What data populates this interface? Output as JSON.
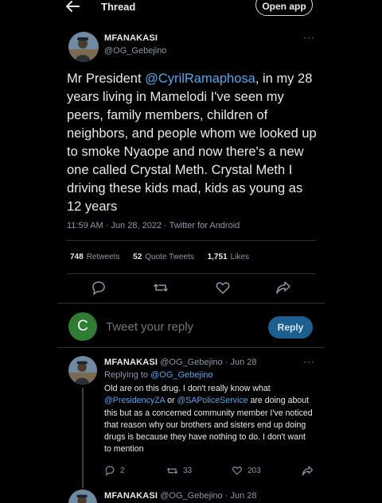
{
  "header": {
    "title": "Thread",
    "open_app": "Open app"
  },
  "tweet": {
    "author_name": "MFANAKASI",
    "author_handle": "@OG_Gebejino",
    "body_prefix": "Mr President ",
    "body_mention": "@CyrilRamaphosa",
    "body_rest": ", in my 28 years living in Mamelodi I've seen my peers, family members, children of neighbors, and people whom we looked up to smoke Nyaope and now there's a new one called Crystal Meth. Crystal Meth I driving these kids mad, kids as young as 12 years",
    "timestamp": "11:59 AM · Jun 28, 2022 · Twitter for Android",
    "stats": {
      "retweets": "748",
      "retweets_label": "Retweets",
      "quotes": "52",
      "quotes_label": "Quote Tweets",
      "likes": "1,751",
      "likes_label": "Likes"
    }
  },
  "compose": {
    "avatar_letter": "C",
    "avatar_color": "#2e7d32",
    "placeholder": "Tweet your reply",
    "button": "Reply"
  },
  "reply": {
    "author_name": "MFANAKASI",
    "meta": "@OG_Gebejino · Jun 28",
    "replying_prefix": "Replying to ",
    "replying_handle": "@OG_Gebejino",
    "text_1": "Old are on this drug. I don't really know what ",
    "mention_1": "@PresidencyZA",
    "text_2": " or ",
    "mention_2": "@SAPoliceService",
    "text_3": " are doing about this but as a concerned community member I've noticed that reason why our brothers and sisters end up doing drugs is because they have nothing to do. I don't want to mention",
    "replies": "2",
    "retweets": "33",
    "likes": "203"
  },
  "next_reply": {
    "author_name": "MFANAKASI",
    "meta": "@OG_Gebejino · Jun 28"
  },
  "colors": {
    "accent": "#1d9bf0",
    "link": "#4ca8ee",
    "background": "#000000"
  },
  "icons": [
    "back-arrow-icon",
    "more-icon",
    "reply-icon",
    "retweet-icon",
    "like-icon",
    "share-icon"
  ]
}
